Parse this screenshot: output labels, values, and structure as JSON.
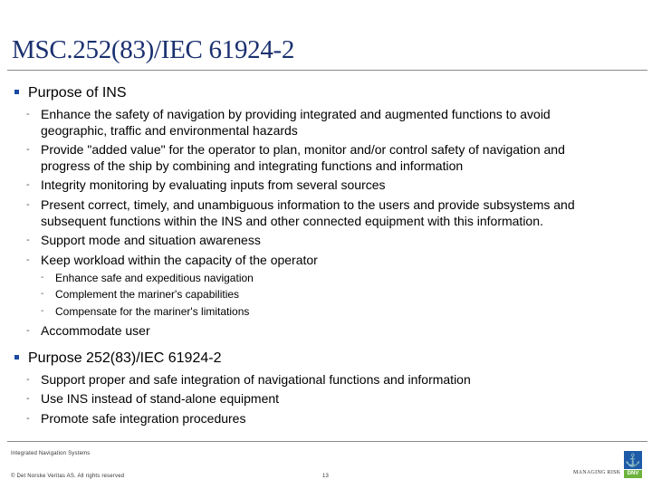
{
  "slide": {
    "title": "MSC.252(83)/IEC 61924-2",
    "sections": [
      {
        "heading": "Purpose of INS",
        "items": [
          {
            "lines": [
              "Enhance the safety of navigation by providing integrated and augmented functions to avoid",
              "geographic, traffic and environmental hazards"
            ]
          },
          {
            "lines": [
              "Provide \"added value\" for the operator to plan, monitor and/or control safety of navigation and",
              "progress of the ship by combining and integrating functions and information"
            ]
          },
          {
            "lines": [
              "Integrity monitoring by evaluating inputs from several sources"
            ]
          },
          {
            "lines": [
              "Present correct, timely, and unambiguous information to the users and provide subsystems and",
              "subsequent functions within the INS and other connected equipment with this information."
            ]
          },
          {
            "lines": [
              "Support mode and situation awareness"
            ]
          },
          {
            "lines": [
              "Keep workload within the capacity of the operator"
            ],
            "subitems": [
              "Enhance safe and expeditious navigation",
              "Complement the mariner's capabilities",
              "Compensate for the mariner's limitations"
            ]
          },
          {
            "lines": [
              "Accommodate user"
            ]
          }
        ]
      },
      {
        "heading": "Purpose 252(83)/IEC 61924-2",
        "items": [
          {
            "lines": [
              "Support proper and safe integration of navigational functions and information"
            ]
          },
          {
            "lines": [
              "Use INS instead of stand-alone equipment"
            ]
          },
          {
            "lines": [
              "Promote safe integration procedures"
            ]
          }
        ]
      }
    ],
    "bullet_dash": "-",
    "accent_color": "#1a4aa0",
    "title_color": "#1a3070"
  },
  "footer": {
    "topic": "Integrated Navigation Systems",
    "copyright": "© Det Norske Veritas AS. All rights reserved",
    "page_number": "13",
    "tagline": "MANAGING RISK",
    "logo": {
      "icon": "anchor-figure-icon",
      "text": "DNV",
      "top_color": "#1d5aa8",
      "bottom_color": "#6cb33e"
    }
  }
}
